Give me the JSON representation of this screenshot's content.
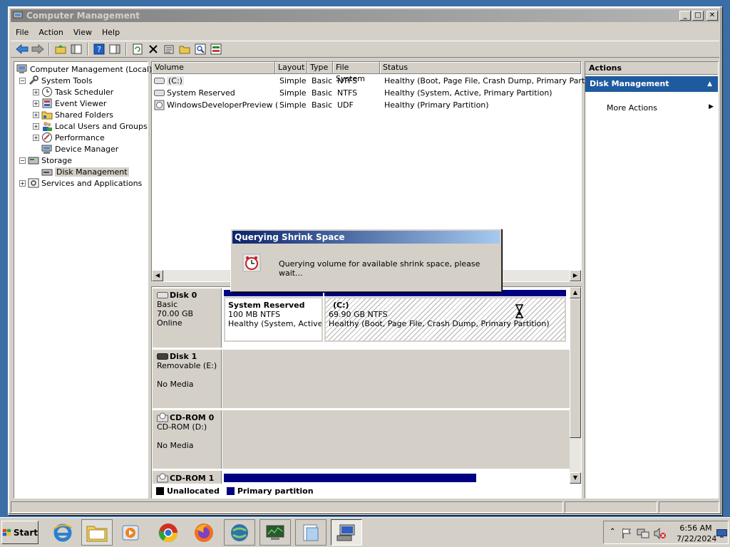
{
  "window": {
    "title": "Computer Management"
  },
  "menu": [
    "File",
    "Action",
    "View",
    "Help"
  ],
  "tree": {
    "root": "Computer Management (Local)",
    "system_tools": "System Tools",
    "task_scheduler": "Task Scheduler",
    "event_viewer": "Event Viewer",
    "shared_folders": "Shared Folders",
    "local_users": "Local Users and Groups",
    "performance": "Performance",
    "device_manager": "Device Manager",
    "storage": "Storage",
    "disk_management": "Disk Management",
    "services": "Services and Applications"
  },
  "volumes": {
    "headers": [
      "Volume",
      "Layout",
      "Type",
      "File System",
      "Status"
    ],
    "rows": [
      {
        "volume": "(C:)",
        "layout": "Simple",
        "type": "Basic",
        "fs": "NTFS",
        "status": "Healthy (Boot, Page File, Crash Dump, Primary Partition)"
      },
      {
        "volume": "System Reserved",
        "layout": "Simple",
        "type": "Basic",
        "fs": "NTFS",
        "status": "Healthy (System, Active, Primary Partition)"
      },
      {
        "volume": "WindowsDeveloperPreview (I:)",
        "layout": "Simple",
        "type": "Basic",
        "fs": "UDF",
        "status": "Healthy (Primary Partition)"
      }
    ]
  },
  "disks": {
    "disk0": {
      "name": "Disk 0",
      "kind": "Basic",
      "size": "70.00 GB",
      "state": "Online"
    },
    "disk0_p1": {
      "name": "System Reserved",
      "size": "100 MB NTFS",
      "status": "Healthy (System, Active, P"
    },
    "disk0_p2": {
      "name": "(C:)",
      "size": "69.90 GB NTFS",
      "status": "Healthy (Boot, Page File, Crash Dump, Primary Partition)"
    },
    "disk1": {
      "name": "Disk 1",
      "kind": "Removable (E:)",
      "state": "No Media"
    },
    "cdrom0": {
      "name": "CD-ROM 0",
      "kind": "CD-ROM (D:)",
      "state": "No Media"
    },
    "cdrom1": {
      "name": "CD-ROM 1"
    }
  },
  "legend": {
    "unallocated": "Unallocated",
    "primary": "Primary partition"
  },
  "actions": {
    "header": "Actions",
    "section": "Disk Management",
    "more": "More Actions"
  },
  "dialog": {
    "title": "Querying Shrink Space",
    "message": "Querying volume for available shrink space, please wait..."
  },
  "taskbar": {
    "start": "Start",
    "time": "6:56 AM",
    "date": "7/22/2024"
  },
  "colors": {
    "primary_partition": "#000080",
    "selection": "#1e5a9e",
    "desktop": "#3a6ea5"
  }
}
